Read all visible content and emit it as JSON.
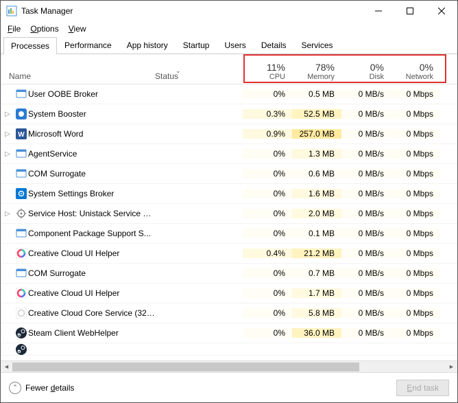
{
  "window": {
    "title": "Task Manager"
  },
  "menu": {
    "file": "File",
    "options": "Options",
    "view": "View"
  },
  "tabs": [
    {
      "label": "Processes",
      "active": true
    },
    {
      "label": "Performance"
    },
    {
      "label": "App history"
    },
    {
      "label": "Startup"
    },
    {
      "label": "Users"
    },
    {
      "label": "Details"
    },
    {
      "label": "Services"
    }
  ],
  "columns": {
    "name": "Name",
    "status": "Status",
    "cpu": {
      "pct": "11%",
      "label": "CPU"
    },
    "memory": {
      "pct": "78%",
      "label": "Memory"
    },
    "disk": {
      "pct": "0%",
      "label": "Disk"
    },
    "network": {
      "pct": "0%",
      "label": "Network"
    }
  },
  "processes": [
    {
      "expandable": false,
      "name": "User OOBE Broker",
      "icon": "window-blue",
      "cpu": "0%",
      "mem": "0.5 MB",
      "disk": "0 MB/s",
      "net": "0 Mbps",
      "cpuh": 0,
      "memh": 0
    },
    {
      "expandable": true,
      "name": "System Booster",
      "icon": "blue-circle",
      "cpu": "0.3%",
      "mem": "52.5 MB",
      "disk": "0 MB/s",
      "net": "0 Mbps",
      "cpuh": 1,
      "memh": 2
    },
    {
      "expandable": true,
      "name": "Microsoft Word",
      "icon": "word",
      "cpu": "0.9%",
      "mem": "257.0 MB",
      "disk": "0 MB/s",
      "net": "0 Mbps",
      "cpuh": 1,
      "memh": 3
    },
    {
      "expandable": true,
      "name": "AgentService",
      "icon": "window-blue",
      "cpu": "0%",
      "mem": "1.3 MB",
      "disk": "0 MB/s",
      "net": "0 Mbps",
      "cpuh": 0,
      "memh": 1
    },
    {
      "expandable": false,
      "name": "COM Surrogate",
      "icon": "window-blue",
      "cpu": "0%",
      "mem": "0.6 MB",
      "disk": "0 MB/s",
      "net": "0 Mbps",
      "cpuh": 0,
      "memh": 0
    },
    {
      "expandable": false,
      "name": "System Settings Broker",
      "icon": "gear-blue",
      "cpu": "0%",
      "mem": "1.6 MB",
      "disk": "0 MB/s",
      "net": "0 Mbps",
      "cpuh": 0,
      "memh": 1
    },
    {
      "expandable": true,
      "name": "Service Host: Unistack Service G...",
      "icon": "gear-gray",
      "cpu": "0%",
      "mem": "2.0 MB",
      "disk": "0 MB/s",
      "net": "0 Mbps",
      "cpuh": 0,
      "memh": 1
    },
    {
      "expandable": false,
      "name": "Component Package Support S...",
      "icon": "window-blue",
      "cpu": "0%",
      "mem": "0.1 MB",
      "disk": "0 MB/s",
      "net": "0 Mbps",
      "cpuh": 0,
      "memh": 0
    },
    {
      "expandable": false,
      "name": "Creative Cloud UI Helper",
      "icon": "cc-color",
      "cpu": "0.4%",
      "mem": "21.2 MB",
      "disk": "0 MB/s",
      "net": "0 Mbps",
      "cpuh": 1,
      "memh": 2
    },
    {
      "expandable": false,
      "name": "COM Surrogate",
      "icon": "window-blue",
      "cpu": "0%",
      "mem": "0.7 MB",
      "disk": "0 MB/s",
      "net": "0 Mbps",
      "cpuh": 0,
      "memh": 0
    },
    {
      "expandable": false,
      "name": "Creative Cloud UI Helper",
      "icon": "cc-color",
      "cpu": "0%",
      "mem": "1.7 MB",
      "disk": "0 MB/s",
      "net": "0 Mbps",
      "cpuh": 0,
      "memh": 1
    },
    {
      "expandable": false,
      "name": "Creative Cloud Core Service (32 ...",
      "icon": "cc-lite",
      "cpu": "0%",
      "mem": "5.8 MB",
      "disk": "0 MB/s",
      "net": "0 Mbps",
      "cpuh": 0,
      "memh": 1
    },
    {
      "expandable": false,
      "name": "Steam Client WebHelper",
      "icon": "steam",
      "cpu": "0%",
      "mem": "36.0 MB",
      "disk": "0 MB/s",
      "net": "0 Mbps",
      "cpuh": 0,
      "memh": 2
    }
  ],
  "footer": {
    "fewer": "Fewer details",
    "end_task": "End task"
  }
}
